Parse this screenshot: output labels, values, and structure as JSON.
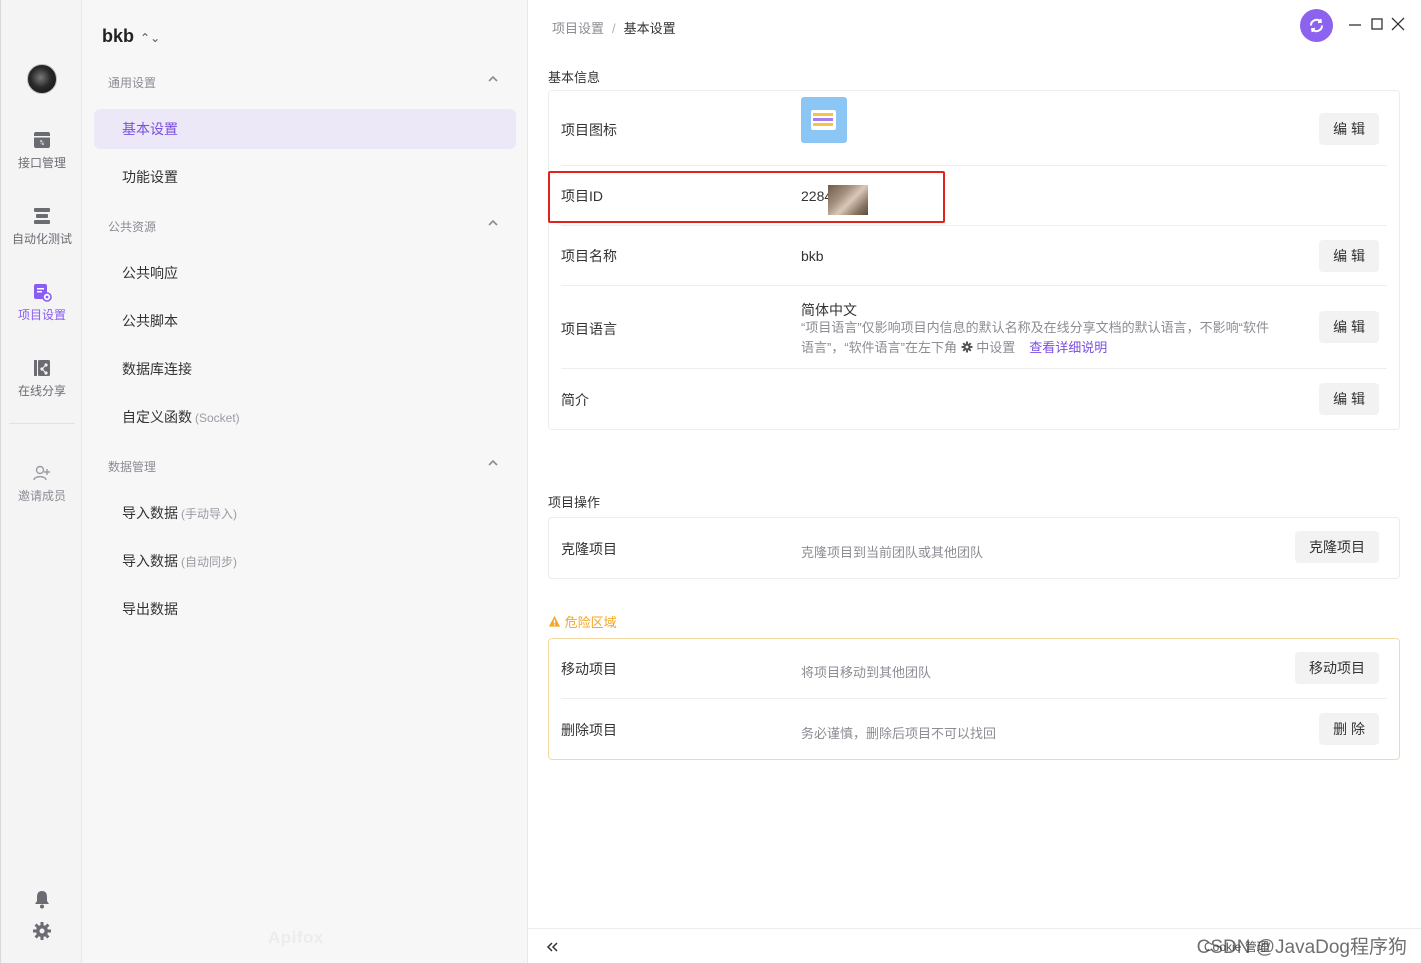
{
  "sidebar": {
    "items": [
      {
        "label": "接口管理",
        "icon": "api-icon"
      },
      {
        "label": "自动化测试",
        "icon": "automation-icon"
      },
      {
        "label": "项目设置",
        "icon": "project-settings-icon"
      },
      {
        "label": "在线分享",
        "icon": "share-icon"
      }
    ],
    "invite_label": "邀请成员",
    "active_color": "#8a5cf6"
  },
  "nav": {
    "project_name": "bkb",
    "sections": {
      "general": "通用设置",
      "public": "公共资源",
      "data": "数据管理"
    },
    "items": {
      "basic": "基本设置",
      "feature": "功能设置",
      "public_response": "公共响应",
      "public_script": "公共脚本",
      "db_conn": "数据库连接",
      "custom_func": "自定义函数",
      "custom_func_sub": "(Socket)",
      "import_manual": "导入数据",
      "import_manual_sub": "(手动导入)",
      "import_auto": "导入数据",
      "import_auto_sub": "(自动同步)",
      "export": "导出数据"
    },
    "watermark": "Apifox"
  },
  "header": {
    "breadcrumb_parent": "项目设置",
    "breadcrumb_sep": "/",
    "breadcrumb_current": "基本设置"
  },
  "basic_info": {
    "title": "基本信息",
    "icon_label": "项目图标",
    "edit": "编 辑",
    "id_label": "项目ID",
    "id_value": "2284",
    "name_label": "项目名称",
    "name_value": "bkb",
    "lang_label": "项目语言",
    "lang_value": "简体中文",
    "lang_note_1": "“项目语言”仅影响项目内信息的默认名称及在线分享文档的默认语言，不影响“软件语言”，“软件语言”在左下角",
    "lang_note_2": "中设置",
    "lang_link": "查看详细说明",
    "intro_label": "简介"
  },
  "ops": {
    "title": "项目操作",
    "clone_label": "克隆项目",
    "clone_desc": "克隆项目到当前团队或其他团队",
    "clone_btn": "克隆项目"
  },
  "danger": {
    "title": "危险区域",
    "move_label": "移动项目",
    "move_desc": "将项目移动到其他团队",
    "move_btn": "移动项目",
    "delete_label": "删除项目",
    "delete_desc": "务必谨慎，删除后项目不可以找回",
    "delete_btn": "删 除",
    "color": "#f5a623"
  },
  "footer": {
    "cookie": "Cookie 管理",
    "watermark": "CSDN @JavaDog程序狗"
  },
  "colors": {
    "accent": "#8c62ee",
    "highlight_border": "#e2231a"
  }
}
